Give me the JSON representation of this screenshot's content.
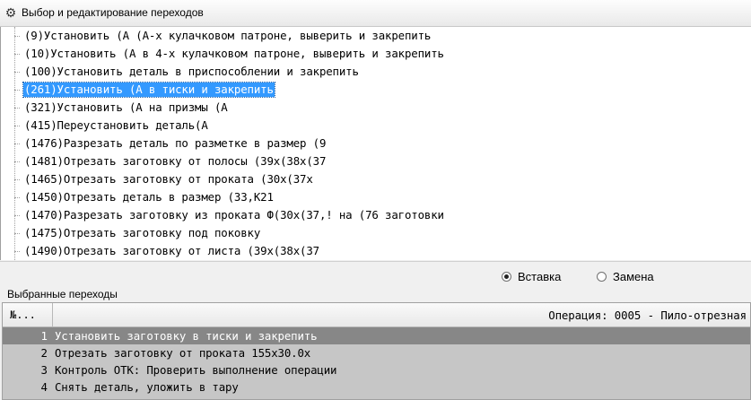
{
  "window": {
    "title": "Выбор и редактирование переходов",
    "icon": "gear-icon"
  },
  "tree": {
    "items": [
      {
        "label": "(9)Установить (А  (А-х кулачковом патроне, выверить и закрепить",
        "selected": false
      },
      {
        "label": "(10)Установить (А в 4-х кулачковом патроне, выверить и закрепить",
        "selected": false
      },
      {
        "label": "(100)Установить деталь в приспособлении и закрепить",
        "selected": false
      },
      {
        "label": "(261)Установить (А в тиски и закрепить",
        "selected": true
      },
      {
        "label": "(321)Установить (А на призмы (А",
        "selected": false
      },
      {
        "label": "(415)Переустановить деталь(А",
        "selected": false
      },
      {
        "label": "(1476)Разрезать деталь по разметке в размер (9",
        "selected": false
      },
      {
        "label": "(1481)Отрезать заготовку от полосы (39х(38х(37",
        "selected": false
      },
      {
        "label": "(1465)Отрезать заготовку от проката (30х(37х",
        "selected": false
      },
      {
        "label": "(1450)Отрезать деталь в размер (33,К21",
        "selected": false
      },
      {
        "label": "(1470)Разрезать заготовку из проката Ф(30х(37,! на (76 заготовки",
        "selected": false
      },
      {
        "label": "(1475)Отрезать заготовку под поковку",
        "selected": false
      },
      {
        "label": "(1490)Отрезать заготовку от листа (39х(38х(37",
        "selected": false
      }
    ]
  },
  "options": {
    "insert": {
      "label": "Вставка",
      "checked": true
    },
    "replace": {
      "label": "Замена",
      "checked": false
    }
  },
  "selected_section": {
    "title": "Выбранные переходы",
    "header": {
      "col_no": "№...",
      "operation": "Операция: 0005 - Пило-отрезная"
    },
    "rows": [
      {
        "num": "1",
        "text": "Установить заготовку в тиски и закрепить",
        "selected": true
      },
      {
        "num": "2",
        "text": "Отрезать заготовку от проката 155х30.0х",
        "selected": false
      },
      {
        "num": "3",
        "text": "Контроль ОТК: Проверить выполнение операции",
        "selected": false
      },
      {
        "num": "4",
        "text": "Снять деталь, уложить в тару",
        "selected": false
      }
    ]
  }
}
